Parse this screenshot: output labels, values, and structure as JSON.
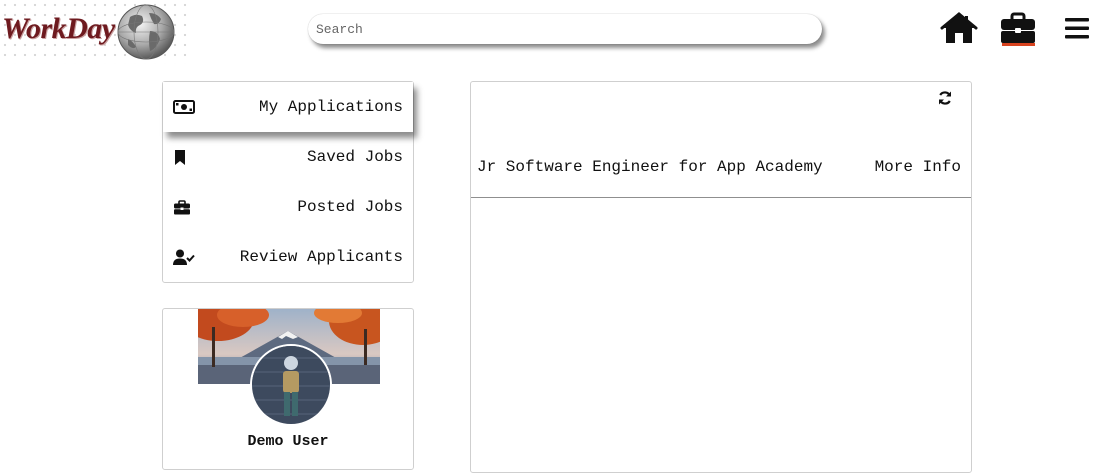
{
  "brand": {
    "logo_text": "WorkDay"
  },
  "search": {
    "placeholder": "Search",
    "value": ""
  },
  "nav": {
    "icons": [
      "home-icon",
      "briefcase-icon",
      "menu-icon"
    ],
    "active": "briefcase-icon",
    "accent_color": "#d8431f"
  },
  "sidebar": {
    "items": [
      {
        "label": "My Applications",
        "icon": "money-bill-icon",
        "active": true
      },
      {
        "label": "Saved Jobs",
        "icon": "bookmark-icon",
        "active": false
      },
      {
        "label": "Posted Jobs",
        "icon": "briefcase-icon",
        "active": false
      },
      {
        "label": "Review Applicants",
        "icon": "user-check-icon",
        "active": false
      }
    ]
  },
  "profile": {
    "name": "Demo User"
  },
  "applications": {
    "items": [
      {
        "title": "Jr Software Engineer for App Academy",
        "action": "More Info"
      }
    ]
  }
}
